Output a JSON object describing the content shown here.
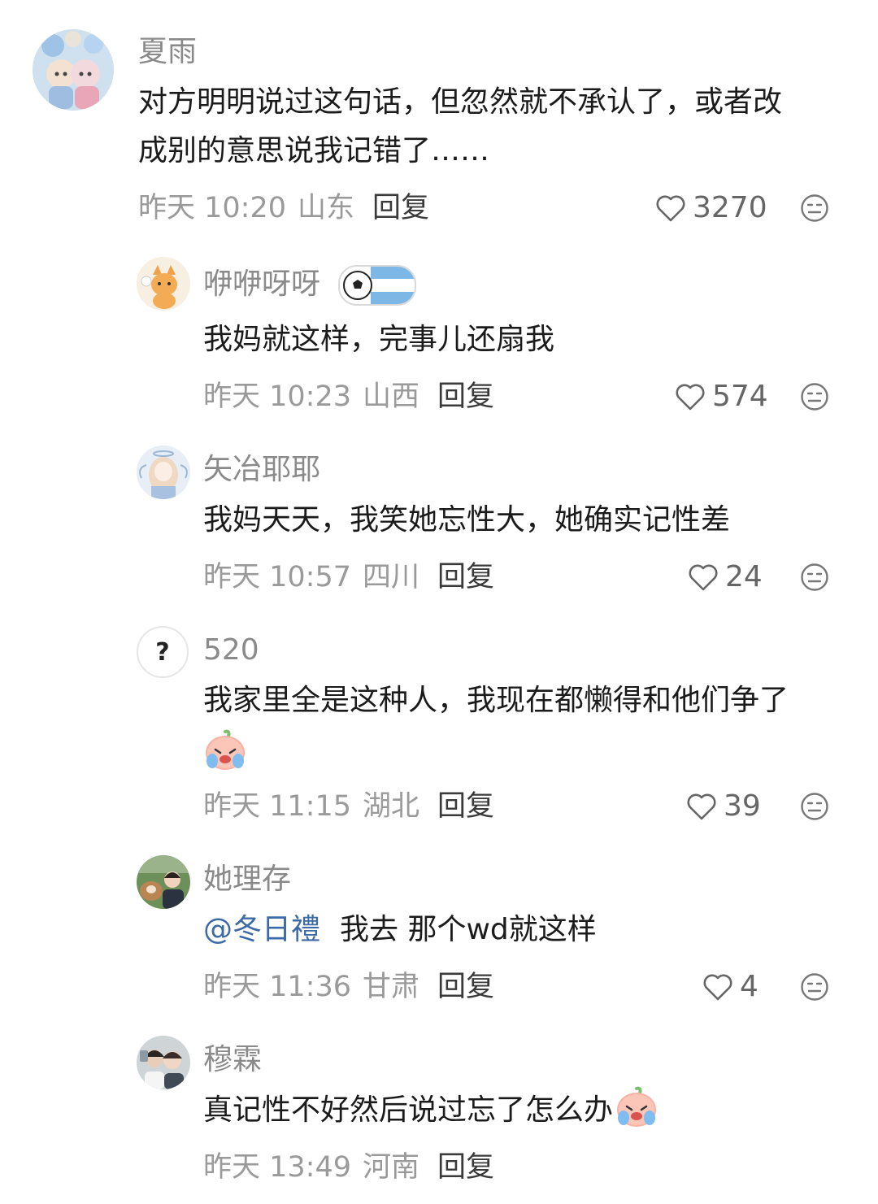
{
  "comments": [
    {
      "name": "夏雨",
      "text_lines": [
        "对方明明说过这句话，但忽然就不承认了，或者改",
        "成别的意思说我记错了……"
      ],
      "time": "昨天 10:20",
      "location": "山东",
      "reply_label": "回复",
      "likes": "3270",
      "avatar_icon": "plush-dolls-avatar"
    },
    {
      "name": "咿咿呀呀",
      "badge_icon": "soccer-argentina-badge",
      "text": "我妈就这样，完事儿还扇我",
      "time": "昨天 10:23",
      "location": "山西",
      "reply_label": "回复",
      "likes": "574",
      "avatar_icon": "orange-cat-avatar"
    },
    {
      "name": "矢冶耶耶",
      "text": "我妈天天，我笑她忘性大，她确实记性差",
      "time": "昨天 10:57",
      "location": "四川",
      "reply_label": "回复",
      "likes": "24",
      "avatar_icon": "anime-angel-avatar"
    },
    {
      "name": "520",
      "text": "我家里全是这种人，我现在都懒得和他们争了",
      "emoji": "crying-peach-emoji",
      "time": "昨天 11:15",
      "location": "湖北",
      "reply_label": "回复",
      "likes": "39",
      "avatar_icon": "question-mark-avatar",
      "avatar_glyph": "?"
    },
    {
      "name": "她理存",
      "mention": "@冬日禮",
      "text": "我去 那个wd就这样",
      "time": "昨天 11:36",
      "location": "甘肃",
      "reply_label": "回复",
      "likes": "4",
      "avatar_icon": "girl-with-dog-avatar"
    },
    {
      "name": "穆霖",
      "text": "真记性不好然后说过忘了怎么办",
      "emoji": "crying-peach-emoji",
      "time": "昨天 13:49",
      "location": "河南",
      "reply_label": "回复",
      "avatar_icon": "friends-photo-avatar"
    }
  ],
  "colors": {
    "name": "#8a8a8a",
    "meta": "#9a9a9a",
    "mention": "#3c6aa6",
    "reply": "#3a3a3a"
  },
  "icons": {
    "like": "heart-outline-icon",
    "dislike": "neutral-face-icon"
  }
}
